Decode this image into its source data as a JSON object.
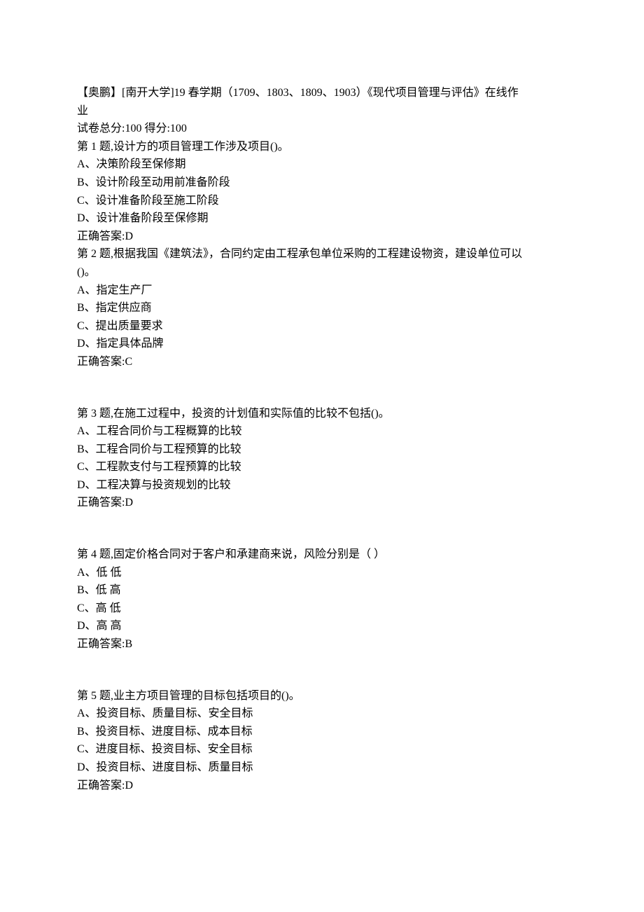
{
  "header": {
    "title_line1": "【奥鹏】[南开大学]19 春学期（1709、1803、1809、1903）《现代项目管理与评估》在线作",
    "title_line2": "业",
    "score_line": "试卷总分:100    得分:100"
  },
  "questions": [
    {
      "stem": "第 1 题,设计方的项目管理工作涉及项目()。",
      "options": [
        "A、决策阶段至保修期",
        "B、设计阶段至动用前准备阶段",
        "C、设计准备阶段至施工阶段",
        "D、设计准备阶段至保修期"
      ],
      "answer": "正确答案:D"
    },
    {
      "stem": "第 2 题,根据我国《建筑法》，合同约定由工程承包单位采购的工程建设物资，建设单位可以",
      "stem2": "()。",
      "options": [
        "A、指定生产厂",
        "B、指定供应商",
        "C、提出质量要求",
        "D、指定具体品牌"
      ],
      "answer": "正确答案:C"
    },
    {
      "stem": "第 3 题,在施工过程中，投资的计划值和实际值的比较不包括()。",
      "options": [
        "A、工程合同价与工程概算的比较",
        "B、工程合同价与工程预算的比较",
        "C、工程款支付与工程预算的比较",
        "D、工程决算与投资规划的比较"
      ],
      "answer": "正确答案:D"
    },
    {
      "stem": "第 4 题,固定价格合同对于客户和承建商来说，风险分别是（       ）",
      "options": [
        "A、低  低",
        "B、低  高",
        "C、高  低",
        "D、高  高"
      ],
      "answer": "正确答案:B"
    },
    {
      "stem": "第 5 题,业主方项目管理的目标包括项目的()。",
      "options": [
        "A、投资目标、质量目标、安全目标",
        "B、投资目标、进度目标、成本目标",
        "C、进度目标、投资目标、安全目标",
        "D、投资目标、进度目标、质量目标"
      ],
      "answer": "正确答案:D"
    }
  ]
}
